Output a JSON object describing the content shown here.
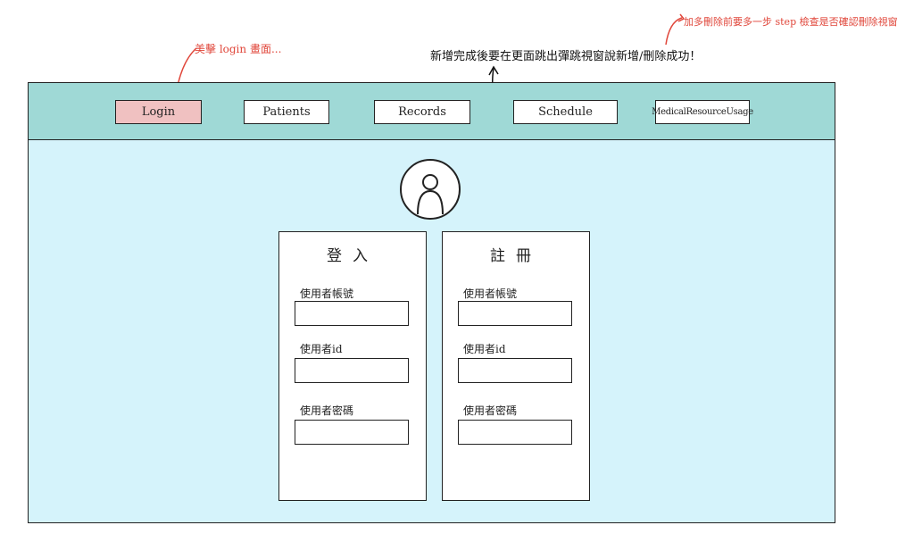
{
  "annotations": {
    "login_note": "美擊 login 畫面...",
    "feedback_note": "新增完成後要在更面跳出彈跳視窗說新增/刪除成功！",
    "delete_note": "加多刪除前要多一步 step 檢查是否確認刪除視窗"
  },
  "nav": {
    "login": "Login",
    "patients": "Patients",
    "records": "Records",
    "schedule": "Schedule",
    "medical_resource_usage": "MedicalResourceUsage",
    "active": "login"
  },
  "login_panel": {
    "title": "登入",
    "account_label": "使用者帳號",
    "id_label": "使用者id",
    "password_label": "使用者密碼",
    "account_value": "",
    "id_value": "",
    "password_value": ""
  },
  "register_panel": {
    "title": "註冊",
    "account_label": "使用者帳號",
    "id_label": "使用者id",
    "password_label": "使用者密碼",
    "account_value": "",
    "id_value": "",
    "password_value": ""
  },
  "colors": {
    "navbar": "#9fd9d6",
    "content": "#d5f3fb",
    "active_button": "#f0c1c1",
    "annotation_red": "#e0463a"
  },
  "icons": {
    "avatar": "user-avatar-icon"
  }
}
